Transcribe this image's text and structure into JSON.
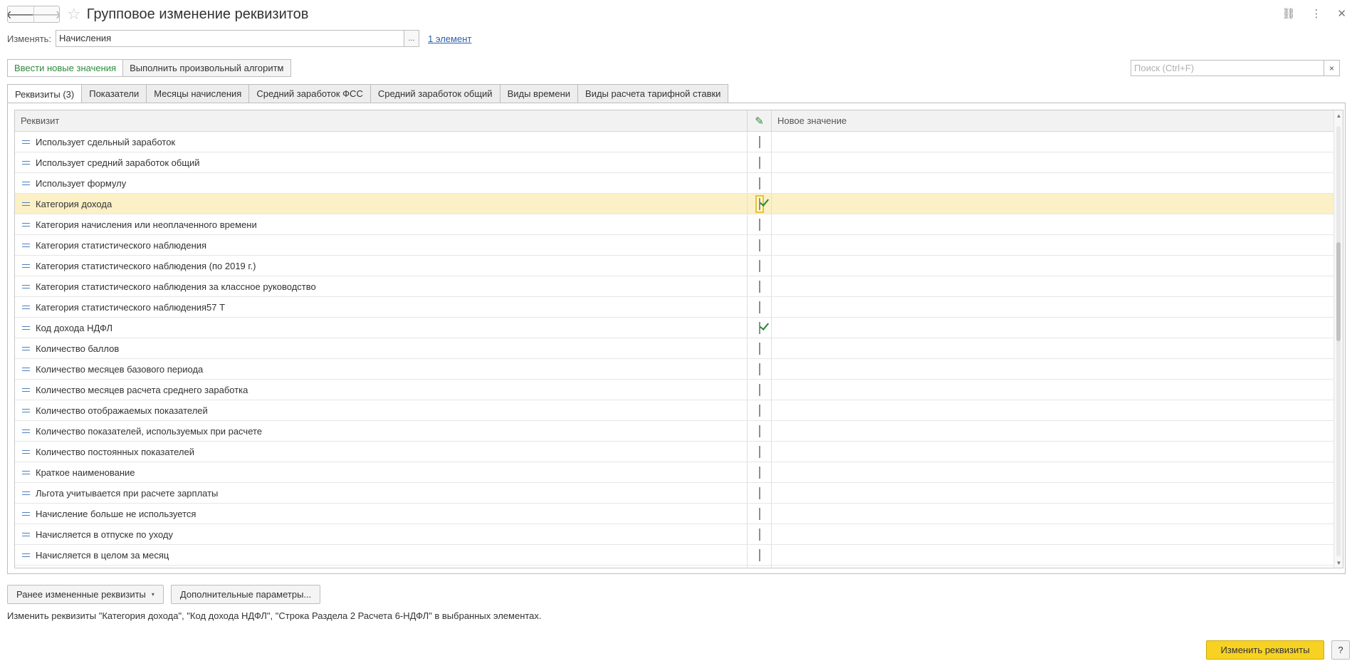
{
  "window": {
    "title": "Групповое изменение реквизитов",
    "nav_back_icon": "🡐",
    "nav_forward_icon": "🡒",
    "star_icon": "☆",
    "link_icon": "⛓",
    "more_icon": "⋮",
    "close_icon": "✕"
  },
  "edit_target": {
    "label": "Изменять:",
    "value": "Начисления",
    "choose_button": "...",
    "count_link": "1 элемент"
  },
  "operation_buttons": {
    "enter_new_values": "Ввести новые значения",
    "run_custom_algorithm": "Выполнить произвольный алгоритм"
  },
  "search": {
    "placeholder": "Поиск (Ctrl+F)",
    "clear_icon": "×"
  },
  "tabs": [
    {
      "label": "Реквизиты (3)",
      "active": true
    },
    {
      "label": "Показатели",
      "active": false
    },
    {
      "label": "Месяцы начисления",
      "active": false
    },
    {
      "label": "Средний заработок ФСС",
      "active": false
    },
    {
      "label": "Средний заработок общий",
      "active": false
    },
    {
      "label": "Виды времени",
      "active": false
    },
    {
      "label": "Виды расчета тарифной ставки",
      "active": false
    }
  ],
  "grid": {
    "columns": {
      "attribute": "Реквизит",
      "edit_icon": "✎",
      "new_value": "Новое значение"
    },
    "rows": [
      {
        "name": "Использует сдельный заработок",
        "checked": false
      },
      {
        "name": "Использует средний заработок общий",
        "checked": false
      },
      {
        "name": "Использует формулу",
        "checked": false
      },
      {
        "name": "Категория дохода",
        "checked": true,
        "selected": true
      },
      {
        "name": "Категория начисления или неоплаченного времени",
        "checked": false
      },
      {
        "name": "Категория статистического наблюдения",
        "checked": false
      },
      {
        "name": "Категория статистического наблюдения (по 2019 г.)",
        "checked": false
      },
      {
        "name": "Категория статистического наблюдения за классное руководство",
        "checked": false
      },
      {
        "name": "Категория статистического наблюдения57 Т",
        "checked": false
      },
      {
        "name": "Код дохода НДФЛ",
        "checked": true
      },
      {
        "name": "Количество баллов",
        "checked": false
      },
      {
        "name": "Количество месяцев базового периода",
        "checked": false
      },
      {
        "name": "Количество месяцев расчета среднего заработка",
        "checked": false
      },
      {
        "name": "Количество отображаемых показателей",
        "checked": false
      },
      {
        "name": "Количество показателей, используемых при расчете",
        "checked": false
      },
      {
        "name": "Количество постоянных показателей",
        "checked": false
      },
      {
        "name": "Краткое наименование",
        "checked": false
      },
      {
        "name": "Льгота учитывается при расчете зарплаты",
        "checked": false
      },
      {
        "name": "Начисление больше не используется",
        "checked": false
      },
      {
        "name": "Начисляется в отпуске по уходу",
        "checked": false
      },
      {
        "name": "Начисляется в целом за месяц",
        "checked": false
      },
      {
        "name": "",
        "checked": false
      }
    ],
    "scroll_position": 0.27,
    "scroll_visible": 0.23
  },
  "bottom": {
    "previously_changed": "Ранее измененные реквизиты",
    "dropdown_caret": "▾",
    "extra_params": "Дополнительные параметры...",
    "info": "Изменить реквизиты \"Категория дохода\", \"Код дохода НДФЛ\", \"Строка Раздела 2 Расчета 6-НДФЛ\" в выбранных элементах.",
    "apply_button": "Изменить реквизиты",
    "help_button": "?"
  }
}
